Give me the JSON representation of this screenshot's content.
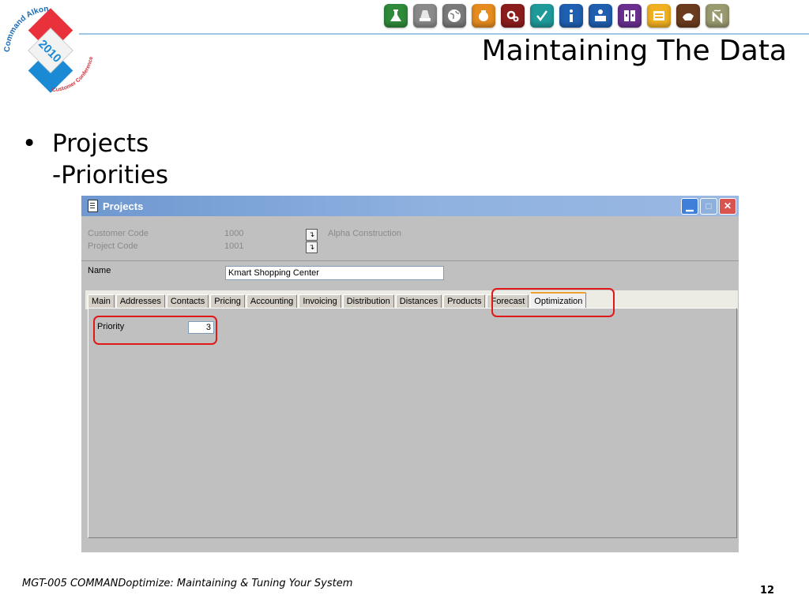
{
  "logo": {
    "top_text": "Command Alkon",
    "year": "2010",
    "bottom_text": "Customer Conference"
  },
  "header_icons": [
    {
      "name": "flask-icon",
      "color": "#2f8a3a"
    },
    {
      "name": "road-icon",
      "color": "#8a8a8a"
    },
    {
      "name": "globe-icon",
      "color": "#7a7a7a"
    },
    {
      "name": "bag-icon",
      "color": "#e58b1f"
    },
    {
      "name": "gears-icon",
      "color": "#8c1d1d"
    },
    {
      "name": "checkmark-icon",
      "color": "#1f9a9a"
    },
    {
      "name": "info-icon",
      "color": "#1f5fb0"
    },
    {
      "name": "person-desk-icon",
      "color": "#1f5fb0"
    },
    {
      "name": "panel-icon",
      "color": "#6a2f8f"
    },
    {
      "name": "folder-icon",
      "color": "#f0b020"
    },
    {
      "name": "hand-icon",
      "color": "#6b3b1e"
    },
    {
      "name": "n-tilde-icon",
      "color": "#9a9a70"
    }
  ],
  "slide": {
    "title": "Maintaining The Data",
    "bullet": "Projects",
    "sub_bullet": "-Priorities"
  },
  "window": {
    "title": "Projects",
    "customer_code_label": "Customer Code",
    "customer_code_value": "1000",
    "customer_name": "Alpha Construction",
    "project_code_label": "Project Code",
    "project_code_value": "1001",
    "name_label": "Name",
    "name_value": "Kmart Shopping Center",
    "tabs": [
      "Main",
      "Addresses",
      "Contacts",
      "Pricing",
      "Accounting",
      "Invoicing",
      "Distribution",
      "Distances",
      "Products",
      "Forecast",
      "Optimization"
    ],
    "active_tab": "Optimization",
    "priority_label": "Priority",
    "priority_value": "3"
  },
  "colors": {
    "highlight": "#e01818",
    "title_bar": "#7fa4d8",
    "rule": "#9fc6e4"
  },
  "footer": {
    "text": "MGT-005 COMMANDoptimize: Maintaining & Tuning Your System",
    "page_number": "12"
  }
}
